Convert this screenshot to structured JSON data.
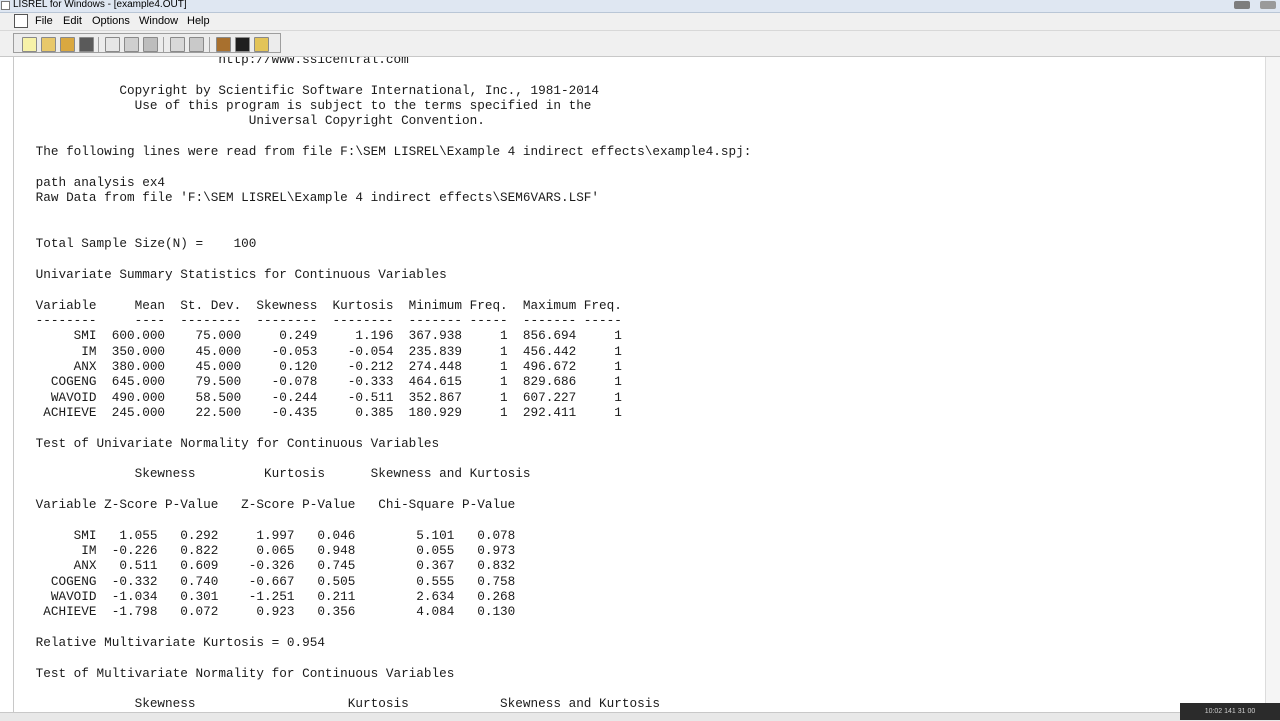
{
  "window": {
    "title": "LISREL for Windows - [example4.OUT]"
  },
  "menubar": {
    "items": [
      "File",
      "Edit",
      "Options",
      "Window",
      "Help"
    ]
  },
  "toolbar": {
    "buttons": [
      "new-file-icon",
      "open-folder-icon",
      "open-file-icon",
      "save-icon",
      "cut-icon",
      "copy-icon",
      "paste-icon",
      "run-lisrel-icon",
      "run-prelis-icon",
      "print-icon",
      "info-icon",
      "help-icon"
    ]
  },
  "output": {
    "lines": [
      "                         http://www.ssicentral.com",
      "",
      "            Copyright by Scientific Software International, Inc., 1981-2014",
      "              Use of this program is subject to the terms specified in the",
      "                             Universal Copyright Convention.",
      "",
      " The following lines were read from file F:\\SEM LISREL\\Example 4 indirect effects\\example4.spj:",
      "",
      " path analysis ex4",
      " Raw Data from file 'F:\\SEM LISREL\\Example 4 indirect effects\\SEM6VARS.LSF'",
      "",
      "",
      " Total Sample Size(N) =    100",
      "",
      " Univariate Summary Statistics for Continuous Variables",
      "",
      " Variable     Mean  St. Dev.  Skewness  Kurtosis  Minimum Freq.  Maximum Freq.",
      " --------     ----  --------  --------  --------  ------- -----  ------- -----",
      "      SMI  600.000    75.000     0.249     1.196  367.938     1  856.694     1",
      "       IM  350.000    45.000    -0.053    -0.054  235.839     1  456.442     1",
      "      ANX  380.000    45.000     0.120    -0.212  274.448     1  496.672     1",
      "   COGENG  645.000    79.500    -0.078    -0.333  464.615     1  829.686     1",
      "   WAVOID  490.000    58.500    -0.244    -0.511  352.867     1  607.227     1",
      "  ACHIEVE  245.000    22.500    -0.435     0.385  180.929     1  292.411     1",
      "",
      " Test of Univariate Normality for Continuous Variables",
      "",
      "              Skewness         Kurtosis      Skewness and Kurtosis",
      "",
      " Variable Z-Score P-Value   Z-Score P-Value   Chi-Square P-Value",
      "",
      "      SMI   1.055   0.292     1.997   0.046        5.101   0.078",
      "       IM  -0.226   0.822     0.065   0.948        0.055   0.973",
      "      ANX   0.511   0.609    -0.326   0.745        0.367   0.832",
      "   COGENG  -0.332   0.740    -0.667   0.505        0.555   0.758",
      "   WAVOID  -1.034   0.301    -1.251   0.211        2.634   0.268",
      "  ACHIEVE  -1.798   0.072     0.923   0.356        4.084   0.130",
      "",
      " Relative Multivariate Kurtosis = 0.954",
      "",
      " Test of Multivariate Normality for Continuous Variables",
      "",
      "              Skewness                    Kurtosis            Skewness and Kurtosis"
    ]
  },
  "taskbar": {
    "clock": "10:02  141 31 00"
  }
}
